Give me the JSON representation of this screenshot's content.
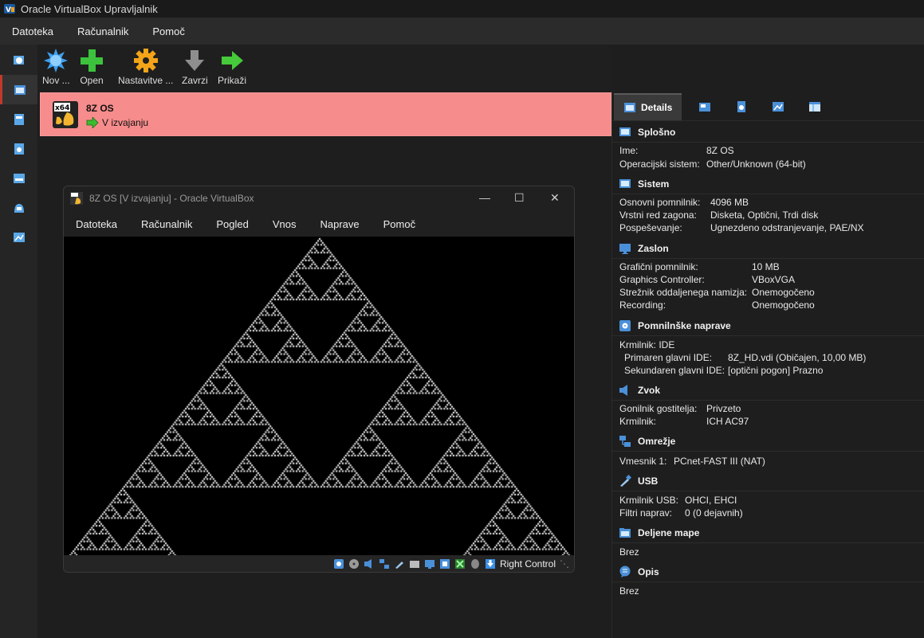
{
  "window": {
    "title": "Oracle VirtualBox Upravljalnik"
  },
  "menubar": [
    "Datoteka",
    "Računalnik",
    "Pomoč"
  ],
  "toolbar": [
    {
      "label": "Nov ...",
      "icon": "new-starburst-icon"
    },
    {
      "label": "Open",
      "icon": "add-plus-icon"
    },
    {
      "label": "Nastavitve ...",
      "icon": "settings-gear-icon"
    },
    {
      "label": "Zavrzi",
      "icon": "discard-arrow-icon"
    },
    {
      "label": "Prikaži",
      "icon": "show-arrow-icon"
    }
  ],
  "vm": {
    "name": "8Z OS",
    "state": "V izvajanju",
    "badge": "x64"
  },
  "vm_window": {
    "title": "8Z OS [V izvajanju] - Oracle VirtualBox",
    "menu": [
      "Datoteka",
      "Računalnik",
      "Pogled",
      "Vnos",
      "Naprave",
      "Pomoč"
    ],
    "host_key": "Right Control"
  },
  "details": {
    "active_tab": "Details",
    "sections": [
      {
        "title": "Splošno",
        "icon": "general-icon",
        "rows": [
          [
            "Ime:",
            "8Z OS"
          ],
          [
            "Operacijski sistem:",
            "Other/Unknown (64-bit)"
          ]
        ]
      },
      {
        "title": "Sistem",
        "icon": "system-icon",
        "rows": [
          [
            "Osnovni pomnilnik:",
            "4096 MB"
          ],
          [
            "Vrstni red zagona:",
            "Disketa, Optični, Trdi disk"
          ],
          [
            "Pospeševanje:",
            "Ugnezdeno odstranjevanje, PAE/NX"
          ]
        ]
      },
      {
        "title": "Zaslon",
        "icon": "display-icon",
        "rows": [
          [
            "Grafični pomnilnik:",
            "10 MB"
          ],
          [
            "Graphics Controller:",
            "VBoxVGA"
          ],
          [
            "Strežnik oddaljenega namizja:",
            "Onemogočeno"
          ],
          [
            "Recording:",
            "Onemogočeno"
          ]
        ]
      },
      {
        "title": "Pomnilnške naprave",
        "icon": "storage-icon",
        "rows": [
          [
            "Krmilnik: IDE",
            ""
          ],
          [
            "  Primaren glavni IDE:",
            "8Z_HD.vdi (Običajen, 10,00 MB)"
          ],
          [
            "  Sekundaren glavni IDE:",
            "[optični pogon] Prazno"
          ]
        ]
      },
      {
        "title": "Zvok",
        "icon": "audio-icon",
        "rows": [
          [
            "Gonilnik gostitelja:",
            "Privzeto"
          ],
          [
            "Krmilnik:",
            "ICH AC97"
          ]
        ]
      },
      {
        "title": "Omrežje",
        "icon": "network-icon",
        "rows": [
          [
            "Vmesnik 1:",
            "PCnet-FAST III (NAT)"
          ]
        ]
      },
      {
        "title": "USB",
        "icon": "usb-icon",
        "rows": [
          [
            "Krmilnik USB:",
            "OHCI, EHCI"
          ],
          [
            "Filtri naprav:",
            "0 (0 dejavnih)"
          ]
        ]
      },
      {
        "title": "Deljene mape",
        "icon": "shared-folder-icon",
        "rows": [
          [
            "Brez",
            ""
          ]
        ]
      },
      {
        "title": "Opis",
        "icon": "description-icon",
        "rows": [
          [
            "Brez",
            ""
          ]
        ]
      }
    ]
  }
}
